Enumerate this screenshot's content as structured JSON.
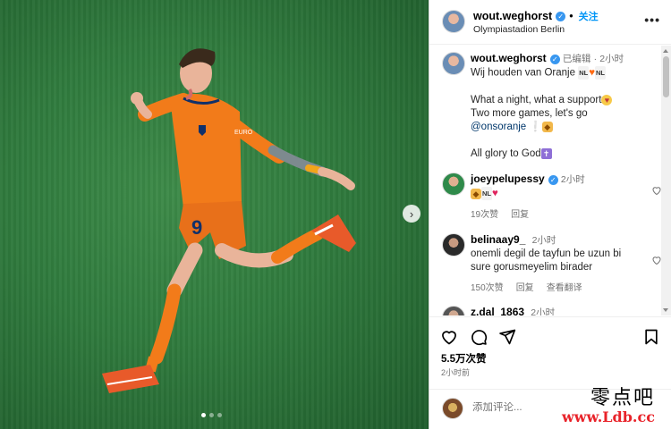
{
  "post": {
    "author": "wout.weghorst",
    "follow_label": "关注",
    "separator": "•",
    "location": "Olympiastadion Berlin",
    "more_label": "•••",
    "carousel_next": "›"
  },
  "caption": {
    "username": "wout.weghorst",
    "edited_label": "已编辑",
    "separator": "·",
    "time": "2小时",
    "line1_text": "Wij houden van Oranje",
    "flag_label": "NL",
    "line2_text": "What a night, what a support",
    "line3_text": "Two more games, let's go",
    "mention": "@onsoranje",
    "line4_text": "All glory to God"
  },
  "comments": [
    {
      "username": "joeypelupessy",
      "time": "2小时",
      "text_flag": "NL",
      "likes": "19次赞",
      "reply_label": "回复"
    },
    {
      "username": "belinaay9_",
      "time": "2小时",
      "text": "onemli degil de tayfun be uzun bi sure gorusmeyelim birader",
      "likes": "150次赞",
      "reply_label": "回复",
      "translate_label": "查看翻译"
    },
    {
      "username": "z.dal_1863",
      "time": "2小时"
    }
  ],
  "actions": {
    "likes_count": "5.5万次赞",
    "posted_time": "2小时前",
    "add_comment_placeholder": "添加评论..."
  },
  "icons": {
    "like": "heart-icon",
    "comment": "comment-icon",
    "share": "paper-plane-icon",
    "save": "bookmark-icon",
    "verified": "verified-badge-icon"
  },
  "colors": {
    "link_blue": "#0095f6",
    "verified_blue": "#3897f0",
    "jersey_orange": "#f27b1a",
    "pitch_green": "#2f7a3d"
  },
  "watermark": {
    "brand_cn": "零点吧",
    "url": "www.Ldb.cc"
  }
}
